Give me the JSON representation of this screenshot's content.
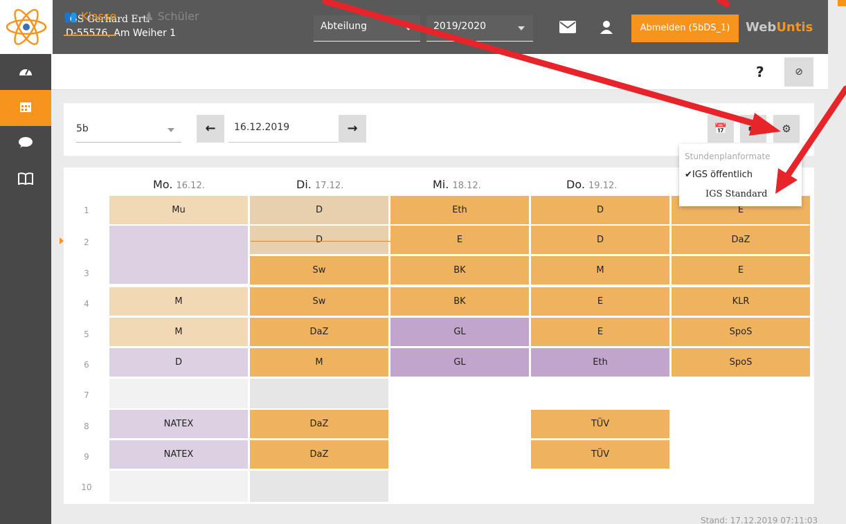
{
  "header": {
    "school_name": "IGS Gerhard Ertl",
    "school_address": "D-55576, Am Weiher 1",
    "department_label": "Abteilung",
    "school_year": "2019/2020",
    "logout_label": "Abmelden (5bDS_1)",
    "brand_web": "Web",
    "brand_untis": "Untis"
  },
  "tabs": [
    {
      "label": "Klasse",
      "active": true
    },
    {
      "label": "Schüler",
      "active": false
    }
  ],
  "filter": {
    "class_value": "5b",
    "date_value": "16.12.2019"
  },
  "dropdown": {
    "header": "Stundenplanformate",
    "item1": "✔IGS öffentlich",
    "item2": "IGS Standard"
  },
  "days": [
    {
      "name": "Mo.",
      "date": "16.12."
    },
    {
      "name": "Di.",
      "date": "17.12."
    },
    {
      "name": "Mi.",
      "date": "18.12."
    },
    {
      "name": "Do.",
      "date": "19.12."
    }
  ],
  "periods": [
    "1",
    "2",
    "3",
    "4",
    "5",
    "6",
    "7",
    "8",
    "9",
    "10"
  ],
  "lessons": {
    "mo": [
      "Mu",
      "M",
      "M",
      "D",
      "NATEX",
      "NATEX"
    ],
    "di": [
      "D",
      "D",
      "Sw",
      "Sw",
      "DaZ",
      "M",
      "DaZ",
      "DaZ"
    ],
    "mi": [
      "Eth",
      "E",
      "BK",
      "BK",
      "GL",
      "GL"
    ],
    "do": [
      "D",
      "D",
      "M",
      "E",
      "E",
      "Eth",
      "TÜV",
      "TÜV"
    ],
    "fr": [
      "E",
      "DaZ",
      "E",
      "KLR",
      "SpoS",
      "SpoS"
    ]
  },
  "footer": {
    "stand": "Stand: 17.12.2019 07:11:03"
  },
  "colors": {
    "accent": "#f7941d",
    "arrow": "#e8242b"
  }
}
